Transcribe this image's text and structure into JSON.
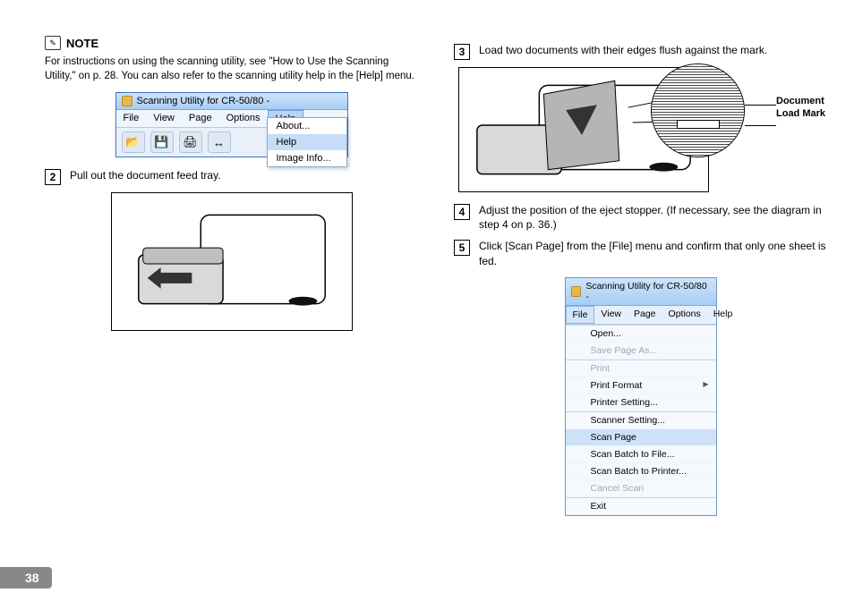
{
  "note": {
    "label": "NOTE",
    "iconText": "✎",
    "body": "For instructions on using the scanning utility, see \"How to Use the Scanning Utility,\" on p. 28. You can also refer to the scanning utility help in the [Help] menu."
  },
  "app1": {
    "title": "Scanning Utility for CR-50/80 -",
    "menus": [
      "File",
      "View",
      "Page",
      "Options",
      "Help"
    ],
    "toolbarIcons": [
      "📂",
      "💾",
      "🖨",
      "↔"
    ],
    "helpMenu": {
      "about": "About...",
      "help": "Help",
      "info": "Image Info..."
    }
  },
  "steps": {
    "s2": {
      "num": "2",
      "text": "Pull out the document feed tray."
    },
    "s3": {
      "num": "3",
      "text": "Load two documents with their edges flush against the mark."
    },
    "s4": {
      "num": "4",
      "text": "Adjust the position of the eject stopper. (If necessary, see the diagram in step 4 on p. 36.)"
    },
    "s5": {
      "num": "5",
      "text": "Click [Scan Page] from the [File] menu and confirm that only one sheet is fed."
    }
  },
  "scannerLabel": {
    "line1": "Document",
    "line2": "Load Mark"
  },
  "app2": {
    "title": "Scanning Utility for CR-50/80 -",
    "menus": [
      "File",
      "View",
      "Page",
      "Options",
      "Help"
    ],
    "fileMenu": {
      "open": "Open...",
      "saveAs": "Save Page As...",
      "print": "Print",
      "printFormat": "Print Format",
      "printerSetting": "Printer Setting...",
      "scannerSetting": "Scanner Setting...",
      "scanPage": "Scan Page",
      "scanBatchFile": "Scan Batch to File...",
      "scanBatchPrinter": "Scan Batch to Printer...",
      "cancelScan": "Cancel Scan",
      "exit": "Exit"
    }
  },
  "pageNumber": "38"
}
